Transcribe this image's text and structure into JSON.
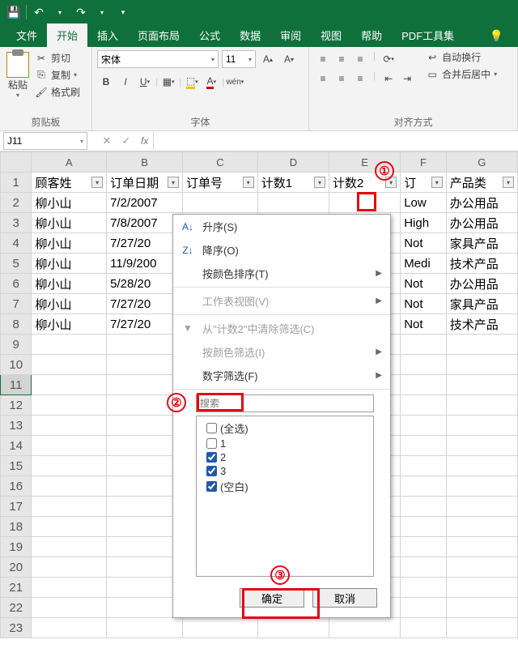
{
  "titlebar": {
    "save": "💾"
  },
  "tabs": {
    "file": "文件",
    "home": "开始",
    "insert": "插入",
    "layout": "页面布局",
    "formula": "公式",
    "data": "数据",
    "review": "审阅",
    "view": "视图",
    "help": "帮助",
    "pdf": "PDF工具集"
  },
  "ribbon": {
    "clipboard": {
      "paste": "粘贴",
      "cut": "剪切",
      "copy": "复制",
      "painter": "格式刷",
      "label": "剪贴板"
    },
    "font": {
      "name": "宋体",
      "size": "11",
      "label": "字体"
    },
    "align": {
      "wrap": "自动换行",
      "merge": "合并后居中",
      "label": "对齐方式"
    }
  },
  "namebox": "J11",
  "columns": [
    "A",
    "B",
    "C",
    "D",
    "E",
    "F",
    "G"
  ],
  "headers": {
    "A": "顾客姓",
    "B": "订单日期",
    "C": "订单号",
    "D": "计数1",
    "E": "计数2",
    "F": "订",
    "G": "产品类"
  },
  "rows": [
    {
      "A": "柳小山",
      "B": "7/2/2007",
      "F": "Low",
      "G": "办公用品"
    },
    {
      "A": "柳小山",
      "B": "7/8/2007",
      "F": "High",
      "G": "办公用品"
    },
    {
      "A": "柳小山",
      "B": "7/27/20",
      "F": "Not",
      "G": "家具产品"
    },
    {
      "A": "柳小山",
      "B": "11/9/200",
      "F": "Medi",
      "G": "技术产品"
    },
    {
      "A": "柳小山",
      "B": "5/28/20",
      "F": "Not",
      "G": "办公用品"
    },
    {
      "A": "柳小山",
      "B": "7/27/20",
      "F": "Not",
      "G": "家具产品"
    },
    {
      "A": "柳小山",
      "B": "7/27/20",
      "F": "Not",
      "G": "技术产品"
    }
  ],
  "dropdown": {
    "asc": "升序(S)",
    "desc": "降序(O)",
    "sortColor": "按颜色排序(T)",
    "sheetView": "工作表视图(V)",
    "clear": "从\"计数2\"中清除筛选(C)",
    "filterColor": "按颜色筛选(I)",
    "numFilter": "数字筛选(F)",
    "searchPlaceholder": "搜索",
    "all": "(全选)",
    "opt1": "1",
    "opt2": "2",
    "opt3": "3",
    "blank": "(空白)",
    "ok": "确定",
    "cancel": "取消"
  },
  "markers": {
    "m1": "①",
    "m2": "②",
    "m3": "③"
  }
}
